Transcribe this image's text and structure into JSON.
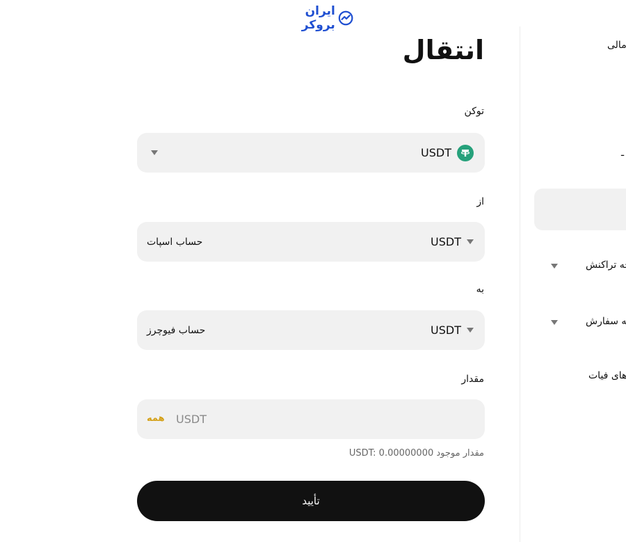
{
  "brand": {
    "name": "ایران بروکر",
    "color": "#1f4fd1"
  },
  "form": {
    "title": "انتقال",
    "token_label": "توکن",
    "token_value": "USDT",
    "token_icon": "tether-icon",
    "from_label": "از",
    "from_token": "USDT",
    "from_account": "حساب اسپات",
    "to_label": "به",
    "to_token": "USDT",
    "to_account": "حساب فیوچرز",
    "amount_label": "مقدار",
    "amount_placeholder": "USDT",
    "amount_all": "همه",
    "balance_label": "مقدار موجود",
    "balance_value": "USDT: 0.00000000",
    "confirm_label": "تأیید"
  },
  "sidebar": {
    "item_top": "مالی",
    "item_mid": "ـ",
    "transactions": "چه تراکنش",
    "orders": "چه سفارش",
    "fiat": "رهای فیات"
  },
  "colors": {
    "accent": "#d4a017",
    "button_bg": "#111111",
    "field_bg": "#f1f1f1",
    "tether": "#26a17b"
  }
}
